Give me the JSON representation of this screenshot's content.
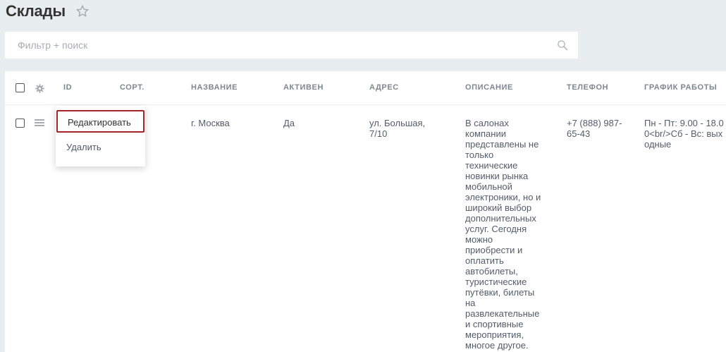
{
  "page": {
    "title": "Склады"
  },
  "filter": {
    "placeholder": "Фильтр + поиск"
  },
  "table": {
    "columns": [
      "ID",
      "СОРТ.",
      "НАЗВАНИЕ",
      "АКТИВЕН",
      "АДРЕС",
      "ОПИСАНИЕ",
      "ТЕЛЕФОН",
      "ГРАФИК РАБОТЫ"
    ],
    "rows": [
      {
        "id": "",
        "sort": "",
        "name": "г. Москва",
        "active": "Да",
        "address": "ул. Большая, 7/10",
        "description": "В салонах компании представлены не только технические новинки рынка мобильной электроники, но и широкий выбор дополнительных услуг. Сегодня можно приобрести и оплатить автобилеты, туристические путёвки, билеты на развлекательные и спортивные мероприятия, многое другое.",
        "phone": "+7 (888) 987-65-43",
        "schedule": "Пн - Пт: 9.00 - 18.00<br/>Сб - Вс: выходные"
      }
    ]
  },
  "context_menu": {
    "items": [
      "Редактировать",
      "Удалить"
    ]
  },
  "icons": {
    "star": "star-icon",
    "search": "search-icon",
    "settings": "gear-icon",
    "row_menu": "hamburger-icon"
  },
  "colors": {
    "background": "#e8eef0",
    "menu_highlight": "#a5252a"
  }
}
